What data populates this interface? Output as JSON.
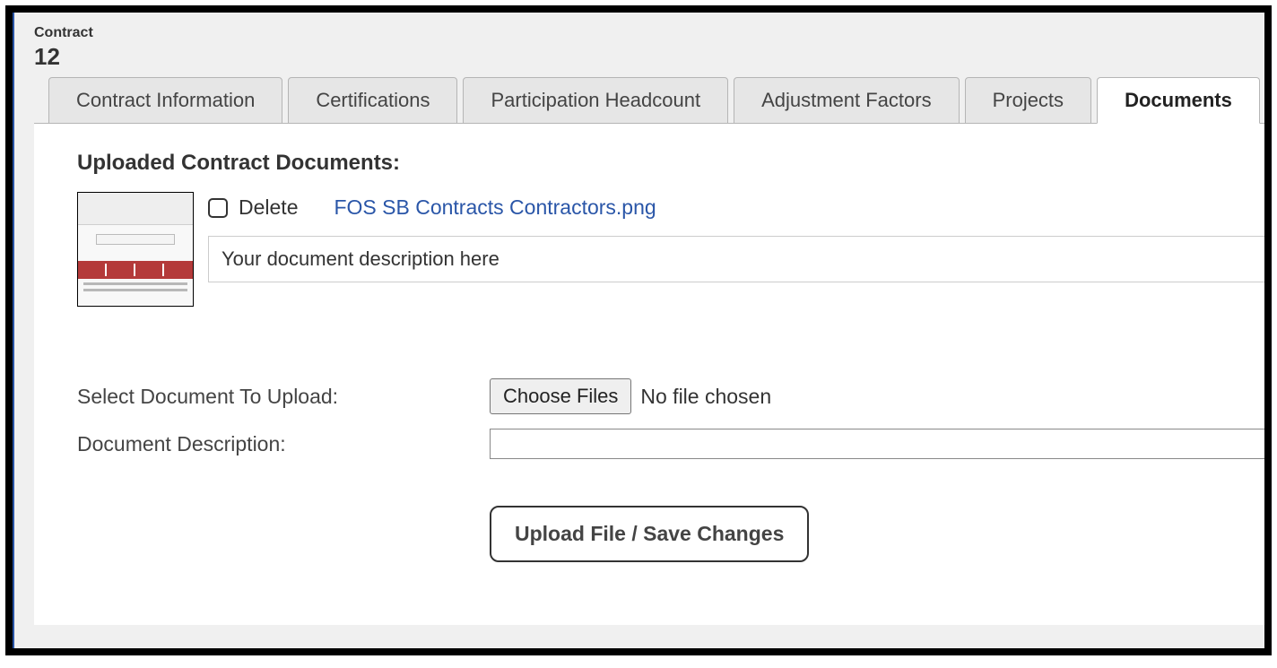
{
  "header": {
    "label": "Contract",
    "number": "12"
  },
  "tabs": [
    {
      "label": "Contract Information",
      "active": false
    },
    {
      "label": "Certifications",
      "active": false
    },
    {
      "label": "Participation Headcount",
      "active": false
    },
    {
      "label": "Adjustment Factors",
      "active": false
    },
    {
      "label": "Projects",
      "active": false
    },
    {
      "label": "Documents",
      "active": true
    }
  ],
  "section": {
    "title": "Uploaded Contract Documents:"
  },
  "documents": [
    {
      "delete_label": "Delete",
      "filename": "FOS SB Contracts Contractors.png",
      "description": "Your document description here"
    }
  ],
  "upload": {
    "select_label": "Select Document To Upload:",
    "choose_button": "Choose Files",
    "no_file_text": "No file chosen",
    "description_label": "Document Description:",
    "submit_button": "Upload File / Save Changes"
  }
}
